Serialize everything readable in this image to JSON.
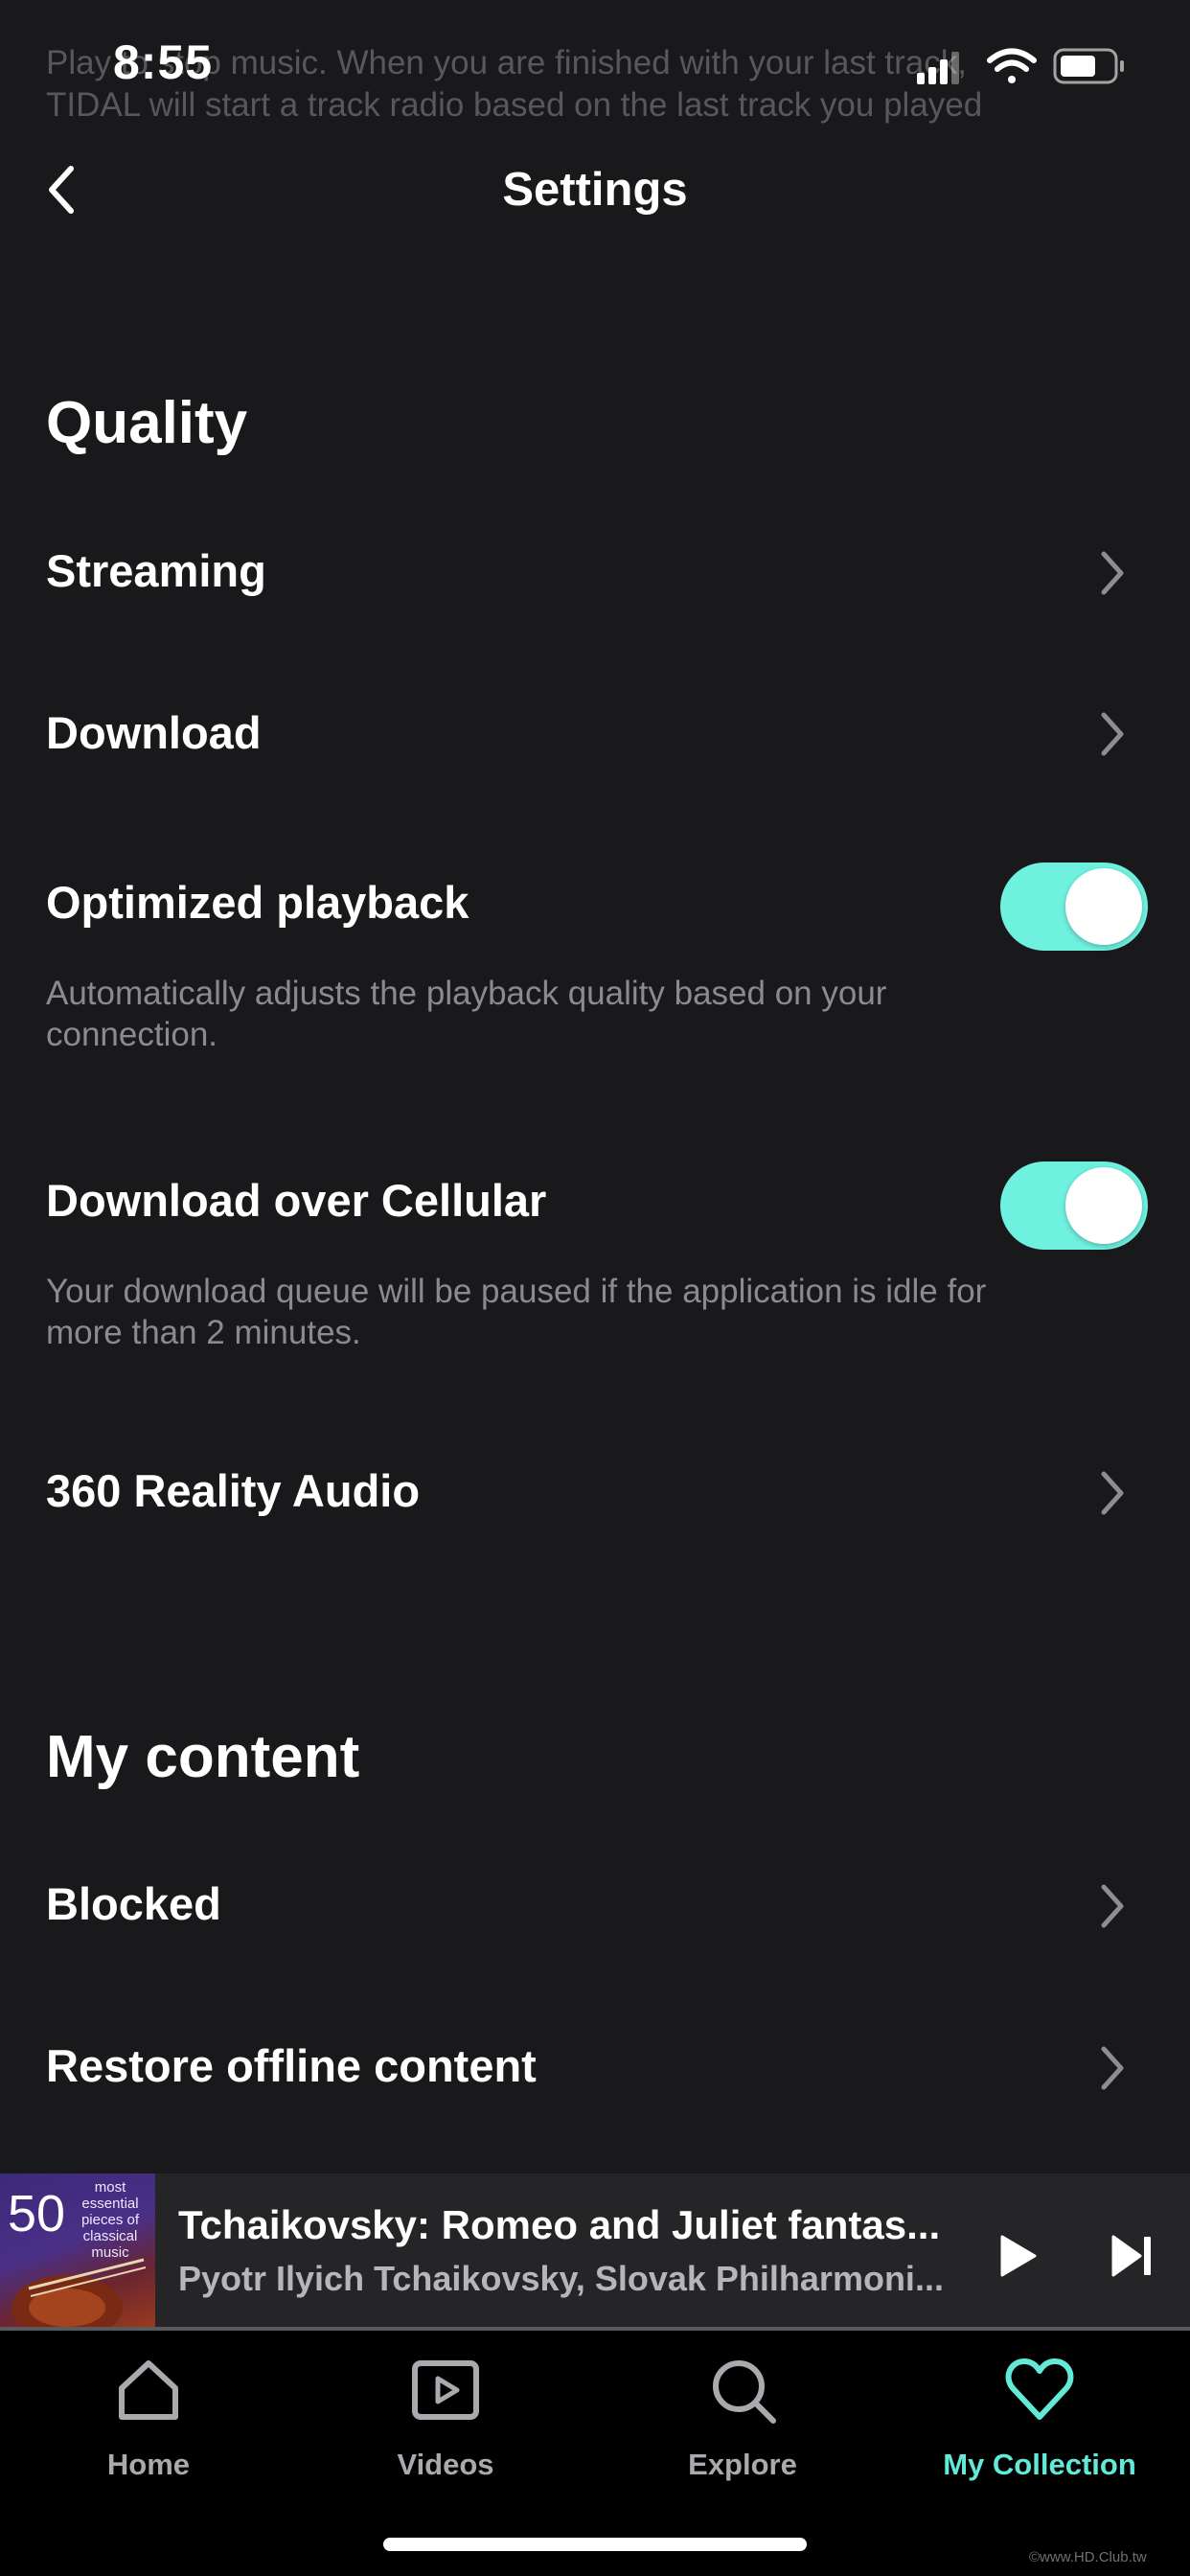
{
  "status_bar": {
    "time": "8:55"
  },
  "ghost_text": "Play to stop music. When you are finished with your last track, TIDAL will start a track radio based on the last track you played",
  "header": {
    "title": "Settings"
  },
  "quality": {
    "title": "Quality",
    "streaming": "Streaming",
    "download": "Download",
    "optimized_playback": {
      "label": "Optimized playback",
      "description": "Automatically adjusts the playback quality based on your connection.",
      "enabled": true
    },
    "download_over_cellular": {
      "label": "Download over Cellular",
      "description": "Your download queue will be paused if the application is idle for more than 2 minutes.",
      "enabled": true
    },
    "reality_audio": "360 Reality Audio"
  },
  "my_content": {
    "title": "My content",
    "blocked": "Blocked",
    "restore_offline": "Restore offline content"
  },
  "mini_player": {
    "album_art_number": "50",
    "album_art_subtitle": "most essential pieces of classical music",
    "track_title": "Tchaikovsky: Romeo and Juliet fantas...",
    "artist": "Pyotr Ilyich Tchaikovsky, Slovak Philharmoni..."
  },
  "tabs": [
    {
      "label": "Home",
      "icon": "home-icon"
    },
    {
      "label": "Videos",
      "icon": "video-icon"
    },
    {
      "label": "Explore",
      "icon": "search-icon"
    },
    {
      "label": "My Collection",
      "icon": "heart-icon",
      "active": true
    }
  ],
  "colors": {
    "accent": "#62e9d8",
    "toggle_on": "#6ff1e0",
    "background": "#19191b"
  },
  "watermark": "©www.HD.Club.tw"
}
